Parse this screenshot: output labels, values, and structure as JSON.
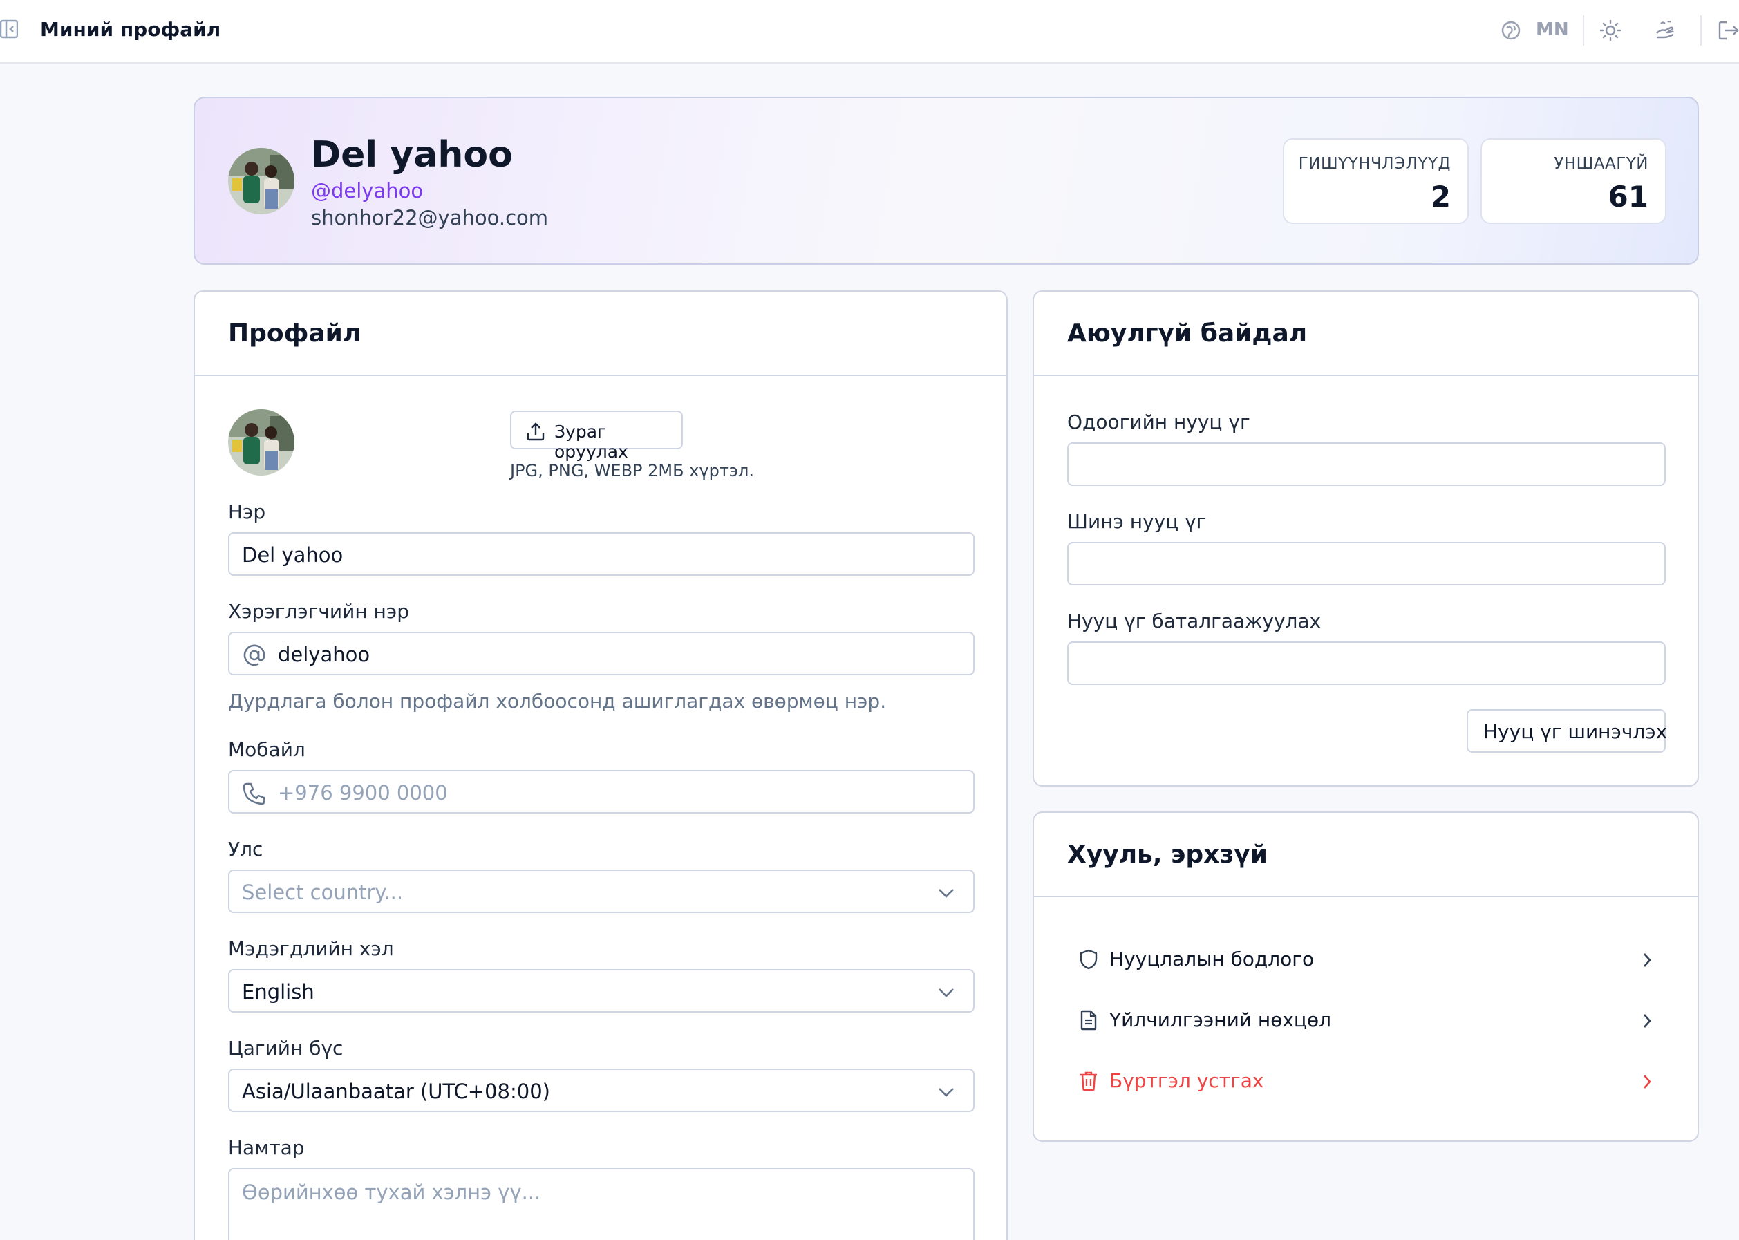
{
  "topbar": {
    "title": "Миний профайл",
    "language": "MN"
  },
  "hero": {
    "name": "Del yahoo",
    "handle": "@delyahoo",
    "email": "shonhor22@yahoo.com",
    "stats": [
      {
        "label": "ГИШҮҮНЧЛЭЛҮҮД",
        "value": "2"
      },
      {
        "label": "УНШААГҮЙ",
        "value": "61"
      }
    ]
  },
  "profile": {
    "title": "Профайл",
    "upload_label": "Зураг оруулах",
    "upload_hint": "JPG, PNG, WEBP 2МБ хүртэл.",
    "name_label": "Нэр",
    "name_value": "Del yahoo",
    "username_label": "Хэрэглэгчийн нэр",
    "username_value": "delyahoo",
    "username_help": "Дурдлага болон профайл холбоосонд ашиглагдах өвөрмөц нэр.",
    "mobile_label": "Мобайл",
    "mobile_placeholder": "+976 9900 0000",
    "country_label": "Улс",
    "country_placeholder": "Select country...",
    "language_label": "Мэдэгдлийн хэл",
    "language_value": "English",
    "timezone_label": "Цагийн бүс",
    "timezone_value": "Asia/Ulaanbaatar (UTC+08:00)",
    "bio_label": "Намтар",
    "bio_placeholder": "Өөрийнхөө тухай хэлнэ үү..."
  },
  "security": {
    "title": "Аюулгүй байдал",
    "current_label": "Одоогийн нууц үг",
    "new_label": "Шинэ нууц үг",
    "confirm_label": "Нууц үг баталгаажуулах",
    "update_button": "Нууц үг шинэчлэх"
  },
  "legal": {
    "title": "Хууль, эрхзүй",
    "items": [
      {
        "label": "Нууцлалын бодлого",
        "icon": "shield-icon"
      },
      {
        "label": "Үйлчилгээний нөхцөл",
        "icon": "document-icon"
      },
      {
        "label": "Бүртгэл устгах",
        "icon": "trash-icon"
      }
    ]
  },
  "colors": {
    "accent": "#7c3aed",
    "danger": "#ef4444",
    "border": "#cfd5e3"
  }
}
